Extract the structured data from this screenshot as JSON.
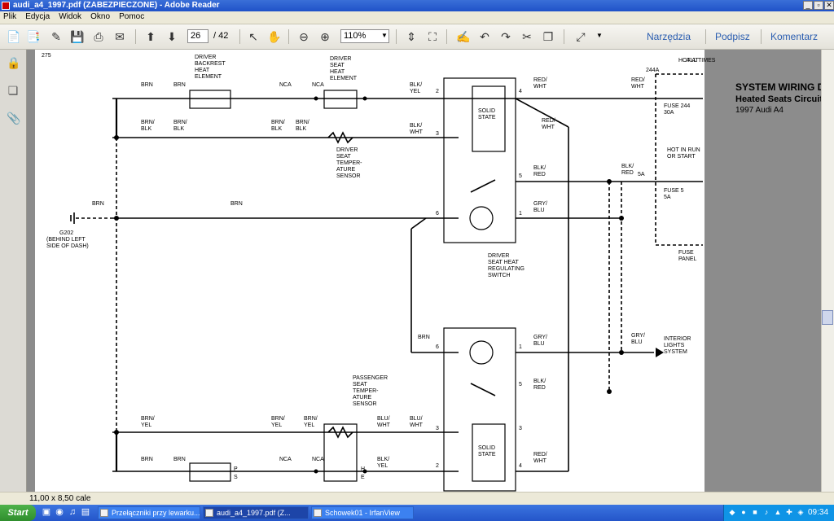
{
  "window": {
    "title": "audi_a4_1997.pdf (ZABEZPIECZONE) - Adobe Reader",
    "controls": [
      "_",
      "▫",
      "✕"
    ]
  },
  "menu": [
    "Plik",
    "Edycja",
    "Widok",
    "Okno",
    "Pomoc"
  ],
  "toolbar": {
    "page_current": "26",
    "page_total": "/ 42",
    "zoom": "110%",
    "panels": [
      "Narzędzia",
      "Podpisz",
      "Komentarz"
    ]
  },
  "status": {
    "page_size": "11,00 x 8,50 cale"
  },
  "taskbar": {
    "start": "Start",
    "tasks": [
      "Przełączniki przy lewarku...",
      "audi_a4_1997.pdf (Z...",
      "Schowek01 - IrfanView"
    ],
    "clock": "09:34"
  },
  "document": {
    "left_margin_label": "275",
    "title_lines": [
      "SYSTEM WIRING DIAGRAMS",
      "Heated Seats Circuit",
      "1997 Audi A4"
    ],
    "labels": [
      {
        "id": "l01",
        "t": "HOT AT"
      },
      {
        "id": "l02",
        "t": "ALL TIMES"
      },
      {
        "id": "l03",
        "t": "244A"
      },
      {
        "id": "l04",
        "t": "RED/"
      },
      {
        "id": "l05",
        "t": "WHT"
      },
      {
        "id": "l06",
        "t": "FUSE 244"
      },
      {
        "id": "l07",
        "t": "30A"
      },
      {
        "id": "l08",
        "t": "HOT IN RUN"
      },
      {
        "id": "l09",
        "t": "OR START"
      },
      {
        "id": "l10",
        "t": "FUSE 5"
      },
      {
        "id": "l11",
        "t": "5A"
      },
      {
        "id": "l12",
        "t": "5A"
      },
      {
        "id": "l13",
        "t": "BLK/"
      },
      {
        "id": "l14",
        "t": "RED"
      },
      {
        "id": "l15",
        "t": "FUSE"
      },
      {
        "id": "l16",
        "t": "PANEL"
      },
      {
        "id": "l17",
        "t": "RED/"
      },
      {
        "id": "l18",
        "t": "WHT"
      },
      {
        "id": "l19",
        "t": "BLK/"
      },
      {
        "id": "l20",
        "t": "RED"
      },
      {
        "id": "l21",
        "t": "GRY/"
      },
      {
        "id": "l22",
        "t": "BLU"
      },
      {
        "id": "l23",
        "t": "RED/"
      },
      {
        "id": "l24",
        "t": "WHT"
      },
      {
        "id": "l25",
        "t": "SOLID"
      },
      {
        "id": "l26",
        "t": "STATE"
      },
      {
        "id": "l27",
        "t": "BLK/"
      },
      {
        "id": "l28",
        "t": "WHT"
      },
      {
        "id": "l29",
        "t": "BLK/"
      },
      {
        "id": "l30",
        "t": "YEL"
      },
      {
        "id": "l31",
        "t": "BRN/"
      },
      {
        "id": "l32",
        "t": "BLK"
      },
      {
        "id": "l33",
        "t": "BRN/"
      },
      {
        "id": "l34",
        "t": "BLK"
      },
      {
        "id": "l35",
        "t": "NCA"
      },
      {
        "id": "l36",
        "t": "NCA"
      },
      {
        "id": "l37",
        "t": "DRIVER"
      },
      {
        "id": "l38",
        "t": "SEAT"
      },
      {
        "id": "l39",
        "t": "HEAT"
      },
      {
        "id": "l40",
        "t": "ELEMENT"
      },
      {
        "id": "l41",
        "t": "DRIVER"
      },
      {
        "id": "l42",
        "t": "BACKREST"
      },
      {
        "id": "l43",
        "t": "HEAT"
      },
      {
        "id": "l44",
        "t": "ELEMENT"
      },
      {
        "id": "l45",
        "t": "BRN"
      },
      {
        "id": "l46",
        "t": "BRN"
      },
      {
        "id": "l47",
        "t": "BRN/"
      },
      {
        "id": "l48",
        "t": "BLK"
      },
      {
        "id": "l49",
        "t": "BRN/"
      },
      {
        "id": "l50",
        "t": "BLK"
      },
      {
        "id": "l51",
        "t": "DRIVER"
      },
      {
        "id": "l52",
        "t": "SEAT"
      },
      {
        "id": "l53",
        "t": "TEMPER-"
      },
      {
        "id": "l54",
        "t": "ATURE"
      },
      {
        "id": "l55",
        "t": "SENSOR"
      },
      {
        "id": "l56",
        "t": "BRN"
      },
      {
        "id": "l57",
        "t": "BRN"
      },
      {
        "id": "l58",
        "t": "G202"
      },
      {
        "id": "l59",
        "t": "(BEHIND LEFT"
      },
      {
        "id": "l60",
        "t": "SIDE OF DASH)"
      },
      {
        "id": "l61",
        "t": "DRIVER"
      },
      {
        "id": "l62",
        "t": "SEAT HEAT"
      },
      {
        "id": "l63",
        "t": "REGULATING"
      },
      {
        "id": "l64",
        "t": "SWITCH"
      },
      {
        "id": "l65",
        "t": "INTERIOR"
      },
      {
        "id": "l66",
        "t": "LIGHTS"
      },
      {
        "id": "l67",
        "t": "SYSTEM"
      },
      {
        "id": "l68",
        "t": "GRY/"
      },
      {
        "id": "l69",
        "t": "BLU"
      },
      {
        "id": "l70",
        "t": "GRY/"
      },
      {
        "id": "l71",
        "t": "BLU"
      },
      {
        "id": "l72",
        "t": "BLK/"
      },
      {
        "id": "l73",
        "t": "RED"
      },
      {
        "id": "l74",
        "t": "BRN"
      },
      {
        "id": "l75",
        "t": "PASSENGER"
      },
      {
        "id": "l76",
        "t": "SEAT"
      },
      {
        "id": "l77",
        "t": "TEMPER-"
      },
      {
        "id": "l78",
        "t": "ATURE"
      },
      {
        "id": "l79",
        "t": "SENSOR"
      },
      {
        "id": "l80",
        "t": "BLU/"
      },
      {
        "id": "l81",
        "t": "WHT"
      },
      {
        "id": "l82",
        "t": "BRN/"
      },
      {
        "id": "l83",
        "t": "YEL"
      },
      {
        "id": "l84",
        "t": "BRN/"
      },
      {
        "id": "l85",
        "t": "YEL"
      },
      {
        "id": "l86",
        "t": "BRN/"
      },
      {
        "id": "l87",
        "t": "YEL"
      },
      {
        "id": "l88",
        "t": "BLK/"
      },
      {
        "id": "l89",
        "t": "YEL"
      },
      {
        "id": "l90",
        "t": "NCA"
      },
      {
        "id": "l91",
        "t": "NCA"
      },
      {
        "id": "l92",
        "t": "BRN"
      },
      {
        "id": "l93",
        "t": "BRN"
      },
      {
        "id": "l94",
        "t": "BLU/"
      },
      {
        "id": "l95",
        "t": "WHT"
      },
      {
        "id": "l96",
        "t": "RED/"
      },
      {
        "id": "l97",
        "t": "WHT"
      },
      {
        "id": "l98",
        "t": "SOLID"
      },
      {
        "id": "l99",
        "t": "STATE"
      },
      {
        "id": "m01",
        "t": "P"
      },
      {
        "id": "m02",
        "t": "S"
      },
      {
        "id": "m03",
        "t": "H"
      },
      {
        "id": "m04",
        "t": "E"
      },
      {
        "id": "p01",
        "t": "4"
      },
      {
        "id": "p02",
        "t": "3"
      },
      {
        "id": "p03",
        "t": "5"
      },
      {
        "id": "p04",
        "t": "1"
      },
      {
        "id": "p05",
        "t": "6"
      },
      {
        "id": "p06",
        "t": "2"
      },
      {
        "id": "p07",
        "t": "3"
      },
      {
        "id": "p08",
        "t": "6"
      },
      {
        "id": "p09",
        "t": "1"
      },
      {
        "id": "p10",
        "t": "5"
      },
      {
        "id": "p11",
        "t": "3"
      },
      {
        "id": "p12",
        "t": "2"
      },
      {
        "id": "p13",
        "t": "4"
      }
    ]
  },
  "icons": {
    "save": "save-icon",
    "print": "print-icon",
    "email": "mail-icon",
    "prev": "arrow-up-icon",
    "next": "arrow-down-icon",
    "select": "cursor-icon",
    "hand": "hand-icon",
    "zoom_out": "minus-circle-icon",
    "zoom_in": "plus-circle-icon"
  },
  "colors": {
    "titlebar": "#1f52c8",
    "taskbar": "#2455c9",
    "panel_link": "#2a5db0",
    "start": "#3a9a37"
  }
}
